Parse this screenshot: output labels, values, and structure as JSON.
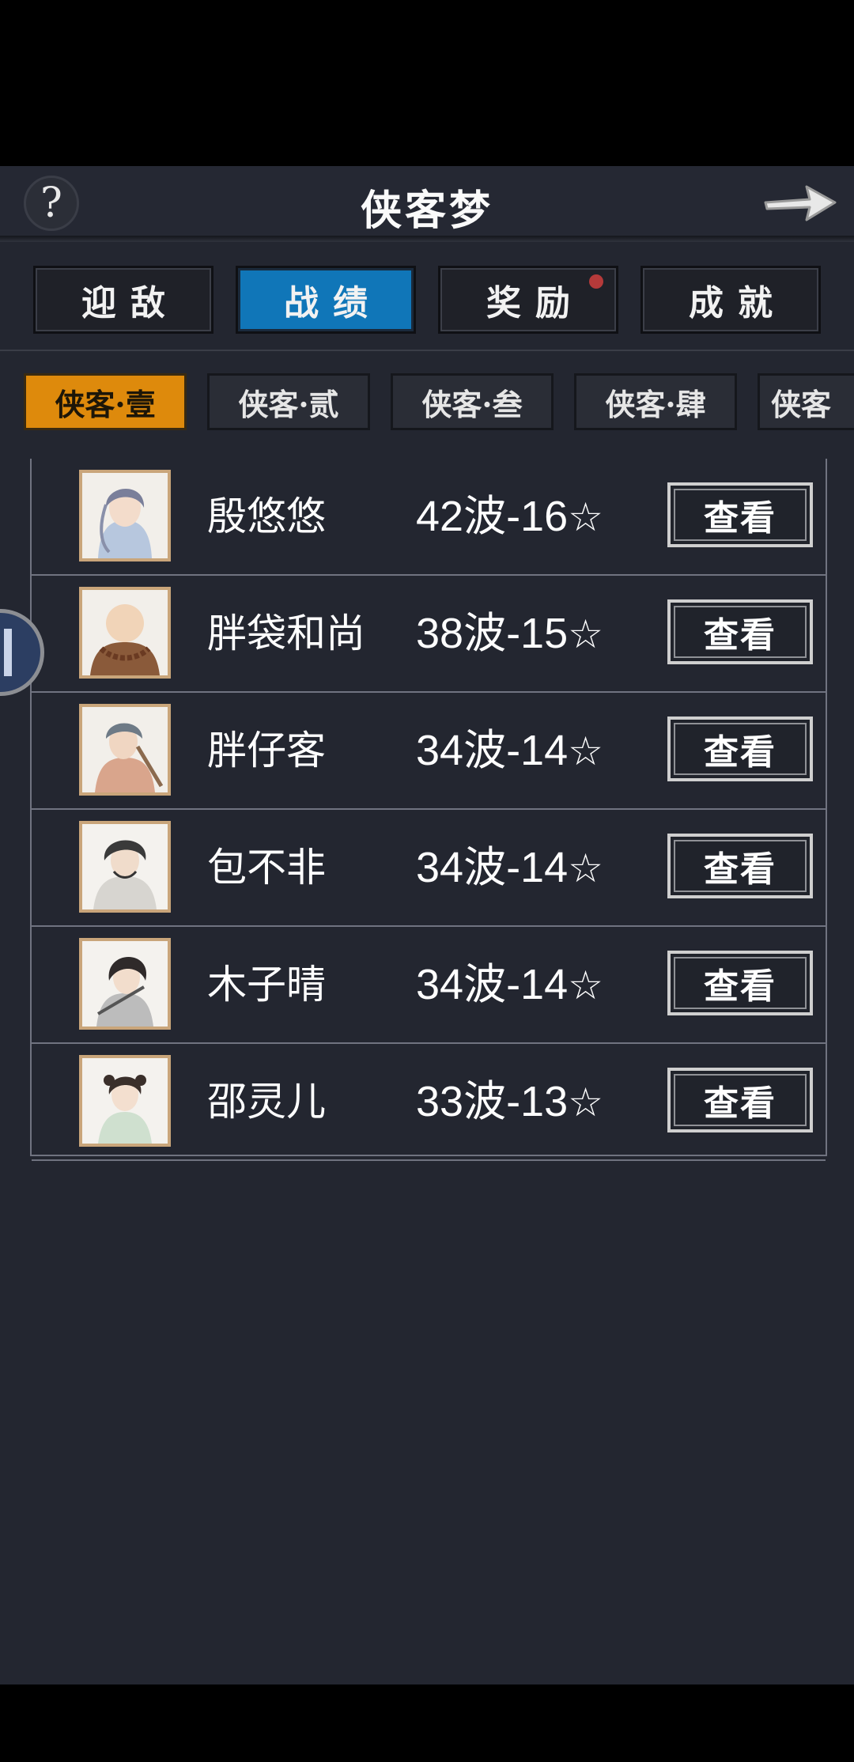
{
  "header": {
    "help_label": "?",
    "title": "侠客梦",
    "exit_icon": "right-arrow-icon"
  },
  "main_tabs": [
    {
      "label": "迎敌",
      "active": false,
      "badge": false
    },
    {
      "label": "战绩",
      "active": true,
      "badge": false
    },
    {
      "label": "奖励",
      "active": false,
      "badge": true
    },
    {
      "label": "成就",
      "active": false,
      "badge": false
    }
  ],
  "sub_tabs": [
    {
      "label": "侠客·壹",
      "active": true
    },
    {
      "label": "侠客·贰",
      "active": false
    },
    {
      "label": "侠客·叁",
      "active": false
    },
    {
      "label": "侠客·肆",
      "active": false
    },
    {
      "label": "侠客",
      "active": false
    }
  ],
  "records": [
    {
      "name": "殷悠悠",
      "score": "42波-16",
      "star": "☆",
      "button": "查看"
    },
    {
      "name": "胖袋和尚",
      "score": "38波-15",
      "star": "☆",
      "button": "查看"
    },
    {
      "name": "胖仔客",
      "score": "34波-14",
      "star": "☆",
      "button": "查看"
    },
    {
      "name": "包不非",
      "score": "34波-14",
      "star": "☆",
      "button": "查看"
    },
    {
      "name": "木子晴",
      "score": "34波-14",
      "star": "☆",
      "button": "查看"
    },
    {
      "name": "邵灵儿",
      "score": "33波-13",
      "star": "☆",
      "button": "查看"
    }
  ],
  "colors": {
    "background": "#232630",
    "active_main_tab": "#1076b8",
    "active_sub_tab": "#de8a0c",
    "badge": "#b53a3a",
    "avatar_frame": "#c9a57a"
  }
}
